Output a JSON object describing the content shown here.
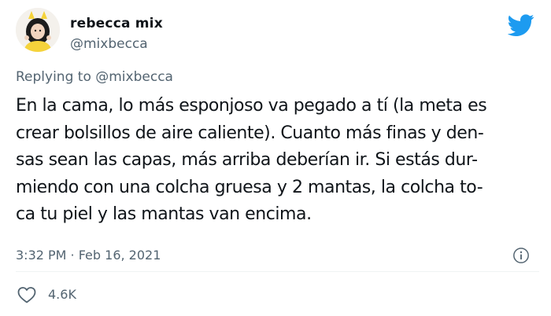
{
  "author": {
    "name": "rebecca mix",
    "handle": "@mixbecca",
    "avatar_icon": "profile-avatar"
  },
  "brand": {
    "icon": "twitter-bird-icon",
    "color": "#1d9bf0"
  },
  "reply": {
    "prefix": "Replying to",
    "mention": "@mixbecca"
  },
  "text_lines": [
    "En la cama, lo más esponjoso va pegado a tí (la meta es",
    "crear bolsillos de aire caliente). Cuanto más finas y den-",
    "sas sean las capas, más arriba deberían ir. Si estás dur-",
    "miendo con una colcha gruesa y 2 mantas, la colcha to-",
    "ca tu piel y las mantas van encima."
  ],
  "timestamp": "3:32 PM · Feb 16, 2021",
  "info_icon": "info-icon",
  "likes": {
    "icon": "heart-icon",
    "count": "4.6K"
  }
}
